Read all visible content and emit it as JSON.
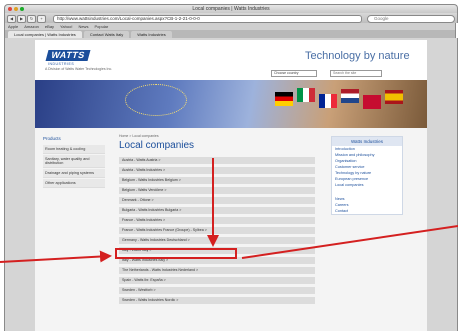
{
  "browser": {
    "window_title": "Local companies | Watts Industries",
    "url": "http://www.wattsindustries.com/Local-companies.aspx?CB-1-2-21-0-0-0",
    "search_placeholder": "Google",
    "bookmarks": [
      "Apple",
      "Amazon",
      "eBay",
      "Yahoo!",
      "News",
      "Popular"
    ],
    "tabs": [
      {
        "label": "Local companies | Watts Industries",
        "active": true
      },
      {
        "label": "Contact Watts Italy",
        "active": false
      },
      {
        "label": "Watts Industries",
        "active": false
      }
    ]
  },
  "site": {
    "logo": "WATTS",
    "logo_sub": "INDUSTRIES",
    "logo_tag": "A Division of Watts Water Technologies Inc.",
    "tagline": "Technology by nature",
    "country_select": "Choose country",
    "search_placeholder": "Search the site"
  },
  "sidebar": {
    "heading": "Products",
    "items": [
      "Room heating & cooling",
      "Sanitary, water quality and distribution",
      "Drainage and piping systems",
      "Other applications"
    ]
  },
  "main": {
    "breadcrumb": "Home > Local companies",
    "title": "Local companies",
    "rows": [
      "Austria - Watts Austria >",
      "Austria - Watts Industries >",
      "Belgium - Watts Industries Belgium >",
      "Belgium - Watts Vendôme >",
      "Denmark - Ottone >",
      "Bulgaria - Watts Industries Bulgaria >",
      "France - Watts Industries >",
      "France - Watts Industries France (Groupe) - Sylbea >",
      "Germany - Watts Industries Deutschland >",
      "Italy - Watts Italy >",
      "Italy - Watts Industries Italy >",
      "The Netherlands - Watts Industries Nederland >",
      "Spain - Watts Ibr. España >",
      "Sweden - Westforb >",
      "Sweden - Watts Industries Nordic >"
    ]
  },
  "right_panel": {
    "heading": "Watts Industries",
    "items": [
      "Introduction",
      "Mission and philosophy",
      "Organisation",
      "Customer service",
      "Technology by nature",
      "European presence",
      "Local companies"
    ],
    "items2": [
      "News",
      "Careers",
      "Contact"
    ]
  },
  "colors": {
    "brand": "#1b4e9b",
    "highlight": "#d42020"
  }
}
